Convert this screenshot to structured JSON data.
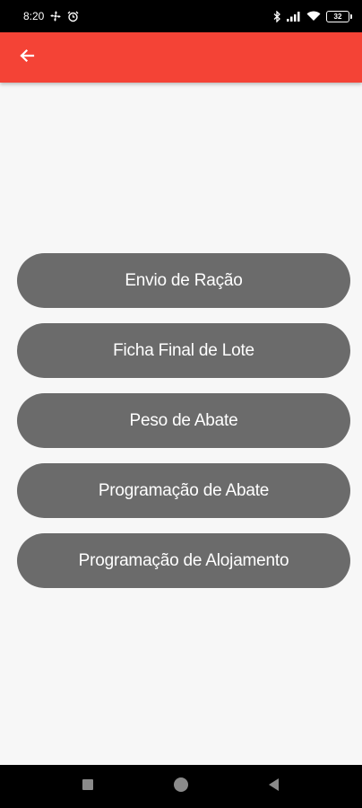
{
  "status_bar": {
    "time": "8:20",
    "battery_level": "32",
    "icons": [
      "fan-icon",
      "alarm-icon",
      "bluetooth-icon",
      "signal-icon",
      "wifi-icon",
      "battery-icon"
    ]
  },
  "app_bar": {
    "background_color": "#f44336",
    "back_icon": "arrow-left-icon"
  },
  "menu": {
    "button_color": "#6b6b6b",
    "items": [
      {
        "label": "Envio de Ração"
      },
      {
        "label": "Ficha Final de Lote"
      },
      {
        "label": "Peso de Abate"
      },
      {
        "label": "Programação de Abate"
      },
      {
        "label": "Programação de Alojamento"
      }
    ]
  },
  "nav_bar": {
    "icons": [
      "recent-apps-icon",
      "home-icon",
      "back-icon"
    ]
  }
}
